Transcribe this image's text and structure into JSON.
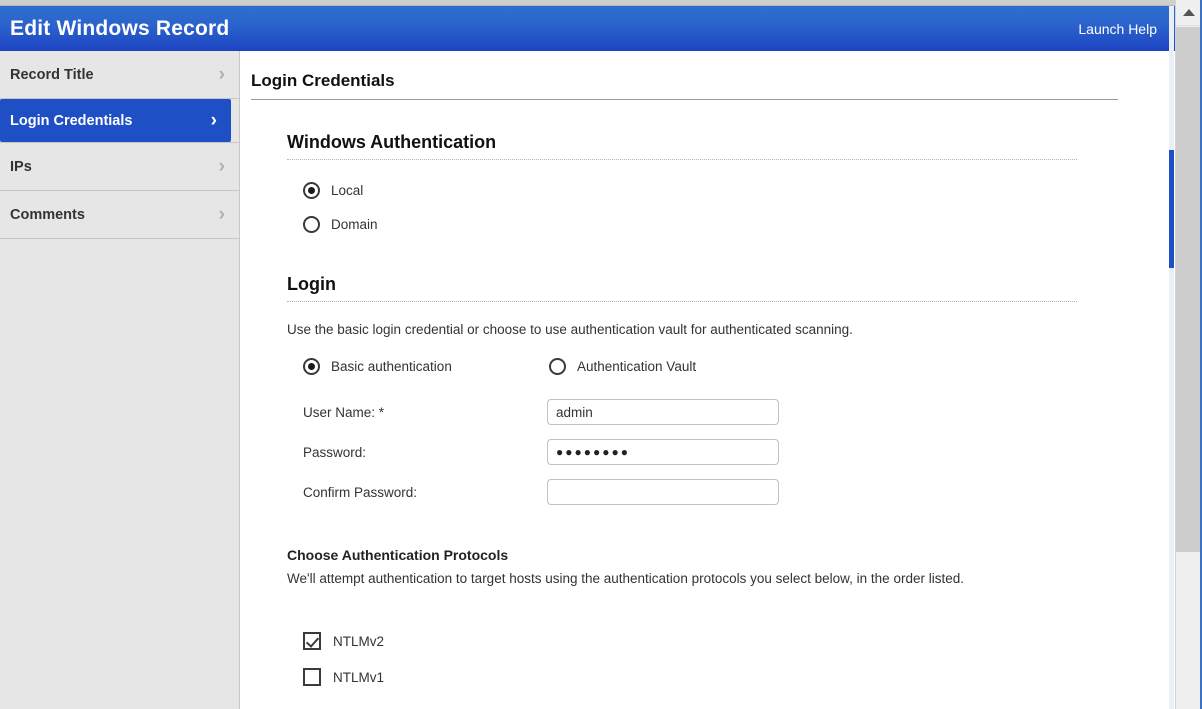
{
  "header": {
    "title": "Edit Windows Record",
    "help_label": "Launch Help"
  },
  "sidebar": {
    "items": [
      {
        "label": "Record Title",
        "chevron": "›",
        "selected": false
      },
      {
        "label": "Login Credentials",
        "chevron": "›",
        "selected": true
      },
      {
        "label": "IPs",
        "chevron": "›",
        "selected": false
      },
      {
        "label": "Comments",
        "chevron": "›",
        "selected": false
      }
    ]
  },
  "main": {
    "page_title": "Login Credentials",
    "windows_auth": {
      "heading": "Windows Authentication",
      "options": [
        {
          "label": "Local",
          "selected": true
        },
        {
          "label": "Domain",
          "selected": false
        }
      ]
    },
    "login": {
      "heading": "Login",
      "description": "Use the basic login credential or choose to use authentication vault for authenticated scanning.",
      "method_options": [
        {
          "label": "Basic authentication",
          "selected": true
        },
        {
          "label": "Authentication Vault",
          "selected": false
        }
      ],
      "fields": [
        {
          "label": "User Name: *",
          "value": "admin",
          "placeholder": "",
          "type": "text"
        },
        {
          "label": "Password:",
          "value": "●●●●●●●●",
          "placeholder": "",
          "type": "password"
        },
        {
          "label": "Confirm Password:",
          "value": "",
          "placeholder": "",
          "type": "password"
        }
      ]
    },
    "protocols": {
      "heading": "Choose Authentication Protocols",
      "description": "We'll attempt authentication to target hosts using the authentication protocols you select below, in the order listed.",
      "options": [
        {
          "label": "NTLMv2",
          "checked": true
        },
        {
          "label": "NTLMv1",
          "checked": false
        }
      ]
    }
  },
  "colors": {
    "header_gradient_top": "#2f6fce",
    "header_gradient_bottom": "#1d43c2",
    "accent_blue": "#1f4fc4",
    "sidebar_bg": "#e6e6e6",
    "scrollbar_thumb": "#cdcdcd"
  }
}
